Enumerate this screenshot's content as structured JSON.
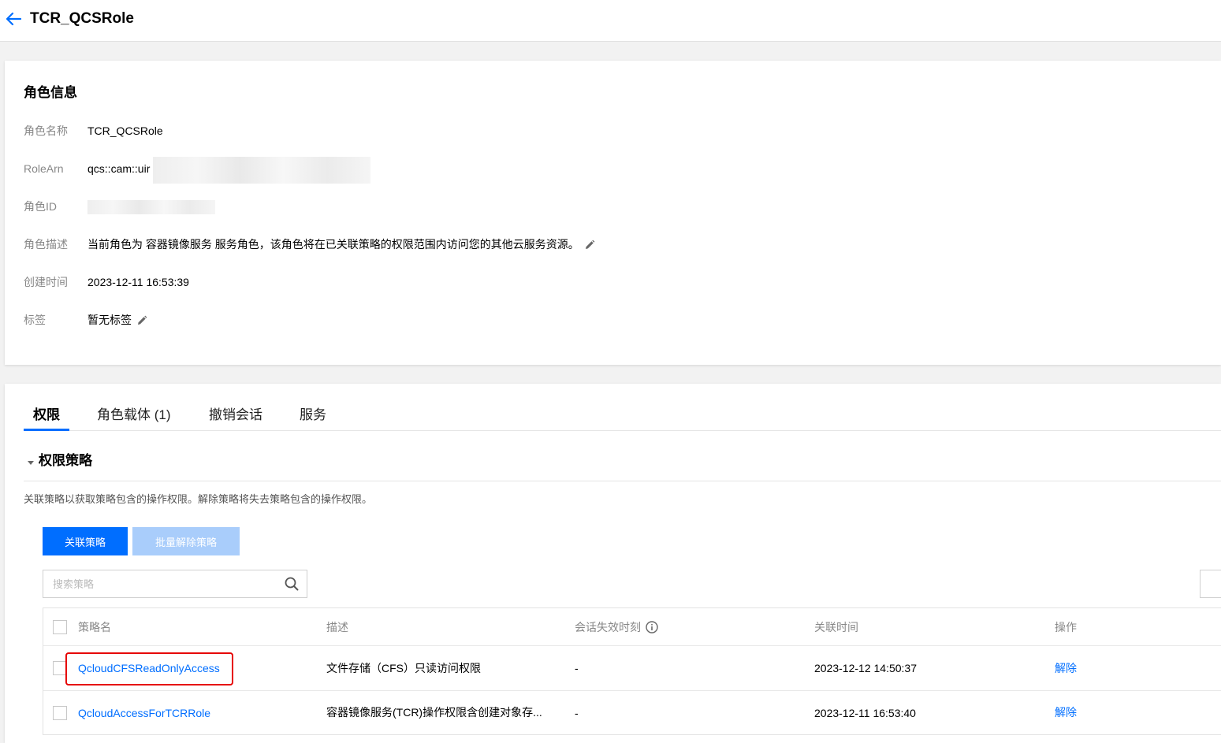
{
  "header": {
    "title": "TCR_QCSRole"
  },
  "role_info": {
    "section_title": "角色信息",
    "rows": [
      {
        "label": "角色名称",
        "value": "TCR_QCSRole"
      },
      {
        "label": "RoleArn",
        "value": "qcs::cam::uir"
      },
      {
        "label": "角色ID",
        "value": ""
      },
      {
        "label": "角色描述",
        "value": "当前角色为 容器镜像服务 服务角色，该角色将在已关联策略的权限范围内访问您的其他云服务资源。"
      },
      {
        "label": "创建时间",
        "value": "2023-12-11 16:53:39"
      },
      {
        "label": "标签",
        "value": "暂无标签"
      }
    ]
  },
  "tabs": [
    {
      "label": "权限",
      "active": true
    },
    {
      "label": "角色载体 (1)",
      "active": false
    },
    {
      "label": "撤销会话",
      "active": false
    },
    {
      "label": "服务",
      "active": false
    }
  ],
  "policies": {
    "section_title": "权限策略",
    "hint": "关联策略以获取策略包含的操作权限。解除策略将失去策略包含的操作权限。",
    "attach_button": "关联策略",
    "batch_detach_button": "批量解除策略",
    "search_placeholder": "搜索策略",
    "columns": [
      "策略名",
      "描述",
      "会话失效时刻",
      "关联时间",
      "操作"
    ],
    "rows": [
      {
        "name": "QcloudCFSReadOnlyAccess",
        "description": "文件存储（CFS）只读访问权限",
        "session_expiry": "-",
        "attached_time": "2023-12-12 14:50:37",
        "action": "解除"
      },
      {
        "name": "QcloudAccessForTCRRole",
        "description": "容器镜像服务(TCR)操作权限含创建对象存...",
        "session_expiry": "-",
        "attached_time": "2023-12-11 16:53:40",
        "action": "解除"
      }
    ]
  },
  "colors": {
    "primary": "#006eff",
    "primary_disabled": "#a9cdfb",
    "highlight": "#e60000"
  }
}
